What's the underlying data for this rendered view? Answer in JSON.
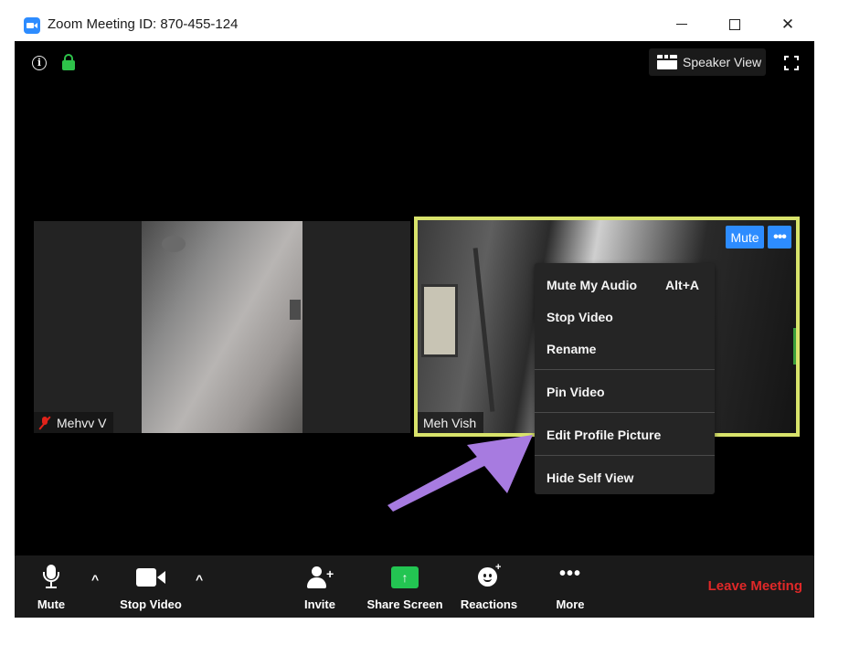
{
  "window": {
    "title": "Zoom Meeting ID: 870-455-124",
    "controls": {
      "minimize": "—",
      "maximize": "☐",
      "close": "✕"
    }
  },
  "top_bar": {
    "speaker_view_label": "Speaker View",
    "icons": [
      "info-icon",
      "lock-icon",
      "grid-icon",
      "fullscreen-icon"
    ]
  },
  "participants": [
    {
      "name": "Mehvv V",
      "audio": "muted"
    },
    {
      "name": "Meh Vish",
      "active_speaker": true,
      "mute_button": "Mute",
      "more_button": "•••"
    }
  ],
  "context_menu": {
    "items": [
      {
        "label": "Mute My Audio",
        "shortcut": "Alt+A"
      },
      {
        "label": "Stop Video"
      },
      {
        "label": "Rename"
      },
      {
        "label": "Pin Video"
      },
      {
        "label": "Edit Profile Picture"
      },
      {
        "label": "Hide Self View"
      }
    ]
  },
  "toolbar": {
    "mute_label": "Mute",
    "stop_video_label": "Stop Video",
    "invite_label": "Invite",
    "share_screen_label": "Share Screen",
    "reactions_label": "Reactions",
    "more_label": "More",
    "leave_label": "Leave Meeting",
    "caret": "^",
    "share_glyph": "↑",
    "more_glyph": "•••"
  },
  "colors": {
    "accent_blue": "#2D8CFF",
    "active_speaker_border": "#D8E36B",
    "share_green": "#23C552",
    "leave_red": "#E02828",
    "muted_red": "#E2231A",
    "annotation_arrow": "#A77BE0"
  }
}
